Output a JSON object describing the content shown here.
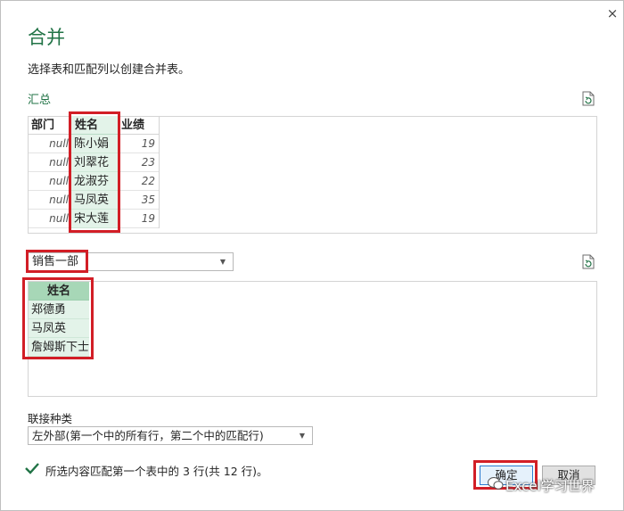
{
  "dialog": {
    "close_glyph": "×",
    "title": "合并",
    "description": "选择表和匹配列以创建合并表。"
  },
  "summary_table": {
    "section_label": "汇总",
    "headers": [
      "部门",
      "姓名",
      "业绩"
    ],
    "rows": [
      [
        "null",
        "陈小娟",
        "19"
      ],
      [
        "null",
        "刘翠花",
        "23"
      ],
      [
        "null",
        "龙淑芬",
        "22"
      ],
      [
        "null",
        "马凤英",
        "35"
      ],
      [
        "null",
        "宋大莲",
        "19"
      ]
    ]
  },
  "second_table": {
    "selected_table": "销售一部",
    "header": "姓名",
    "rows": [
      "郑德勇",
      "马凤英",
      "詹姆斯下士"
    ]
  },
  "join": {
    "label": "联接种类",
    "selected": "左外部(第一个中的所有行，第二个中的匹配行)"
  },
  "status": {
    "text": "所选内容匹配第一个表中的 3 行(共 12 行)。",
    "icon": "check-icon"
  },
  "buttons": {
    "ok": "确定",
    "cancel": "取消"
  },
  "watermark": {
    "text": "Excel学习世界"
  },
  "colors": {
    "accent_green": "#217346",
    "highlight_red": "#d21e26",
    "selected_column": "#e3f3e9",
    "selected_header": "#a7d7b7"
  }
}
